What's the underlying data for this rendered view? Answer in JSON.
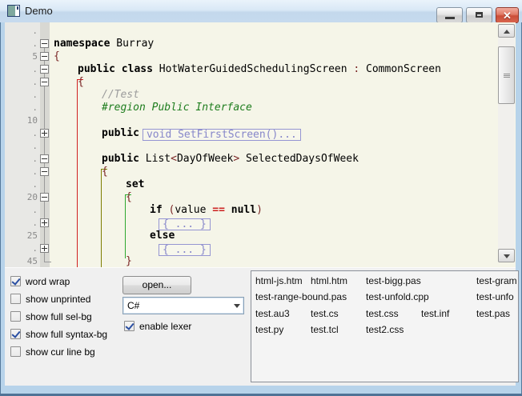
{
  "window": {
    "title": "Demo",
    "buttons": {
      "minimize": "minimize",
      "maximize": "maximize",
      "close": "close"
    }
  },
  "colors": {
    "titlebar_bg": "#D9E8F6",
    "editor_bg": "#F5F5E8",
    "gutter_bg": "#E8E8E5",
    "fold_strip_bg": "#D8D8D3",
    "keyword": "#000000",
    "comment": "#9C9C9C",
    "region_directive": "#1E7D1E",
    "symbol": "#7A2525",
    "operator": "#CC1F1F",
    "folded_text": "#8787CA",
    "scope_red": "#D02020",
    "scope_olive": "#7E7E00",
    "scope_green": "#2EA82E",
    "close_button": "#CB4D38"
  },
  "editor": {
    "rows": [
      {
        "num": ".",
        "fold": "",
        "indent": 0,
        "tokens": []
      },
      {
        "num": ".",
        "fold": "minus",
        "indent": 0,
        "tokens": [
          [
            "kw",
            "namespace"
          ],
          [
            "id",
            " Burray"
          ]
        ]
      },
      {
        "num": "5",
        "fold": "minus",
        "indent": 0,
        "tokens": [
          [
            "sy",
            "{"
          ]
        ]
      },
      {
        "num": ".",
        "fold": "minus",
        "indent": 1,
        "tokens": [
          [
            "kw",
            "public class"
          ],
          [
            "id",
            " HotWaterGuidedSchedulingScreen "
          ],
          [
            "sy",
            ":"
          ],
          [
            "id",
            " CommonScreen"
          ]
        ]
      },
      {
        "num": ".",
        "fold": "minus",
        "indent": 1,
        "tokens": [
          [
            "sy",
            "{"
          ]
        ]
      },
      {
        "num": ".",
        "fold": "",
        "indent": 2,
        "tokens": [
          [
            "cm",
            "//Test"
          ]
        ]
      },
      {
        "num": ".",
        "fold": "",
        "indent": 2,
        "tokens": [
          [
            "rg",
            "#region Public Interface"
          ]
        ]
      },
      {
        "num": "10",
        "fold": "",
        "indent": 0,
        "tokens": []
      },
      {
        "num": ".",
        "fold": "plus",
        "indent": 2,
        "tokens": [
          [
            "kw",
            "public"
          ]
        ],
        "box": "void SetFirstScreen()..."
      },
      {
        "num": ".",
        "fold": "",
        "indent": 0,
        "tokens": []
      },
      {
        "num": ".",
        "fold": "minus",
        "indent": 2,
        "tokens": [
          [
            "kw",
            "public "
          ],
          [
            "id",
            "List"
          ],
          [
            "sy",
            "<"
          ],
          [
            "id",
            "DayOfWeek"
          ],
          [
            "sy",
            ">"
          ],
          [
            "id",
            " SelectedDaysOfWeek"
          ]
        ]
      },
      {
        "num": ".",
        "fold": "minus",
        "indent": 2,
        "tokens": [
          [
            "sy",
            "{"
          ]
        ]
      },
      {
        "num": ".",
        "fold": "",
        "indent": 3,
        "tokens": [
          [
            "kw",
            "set"
          ]
        ]
      },
      {
        "num": "20",
        "fold": "minus",
        "indent": 3,
        "tokens": [
          [
            "sy",
            "{"
          ]
        ]
      },
      {
        "num": ".",
        "fold": "",
        "indent": 4,
        "tokens": [
          [
            "kw",
            "if"
          ],
          [
            "id",
            " "
          ],
          [
            "sy",
            "("
          ],
          [
            "id",
            "value "
          ],
          [
            "op",
            "=="
          ],
          [
            "id",
            " "
          ],
          [
            "kw",
            "null"
          ],
          [
            "sy",
            ")"
          ]
        ]
      },
      {
        "num": ".",
        "fold": "plus",
        "indent": 4,
        "tokens": [],
        "box": "{ ... }"
      },
      {
        "num": "25",
        "fold": "",
        "indent": 4,
        "tokens": [
          [
            "kw",
            "else"
          ]
        ]
      },
      {
        "num": ".",
        "fold": "plus",
        "indent": 4,
        "tokens": [],
        "box": "{ ... }"
      },
      {
        "num": "45",
        "fold": "end",
        "indent": 3,
        "tokens": [
          [
            "sy",
            "}"
          ]
        ]
      }
    ],
    "scope_lines": [
      {
        "color": "#D02020",
        "indent": 1,
        "from_row": 4,
        "to_row": -1
      },
      {
        "color": "#7E7E00",
        "indent": 2,
        "from_row": 11,
        "to_row": -1
      },
      {
        "color": "#2EA82E",
        "indent": 3,
        "from_row": 13,
        "to_row": 18
      }
    ]
  },
  "panel": {
    "checkboxes": [
      {
        "label": "word wrap",
        "checked": true
      },
      {
        "label": "show unprinted",
        "checked": false
      },
      {
        "label": "show full sel-bg",
        "checked": false
      },
      {
        "label": "show full syntax-bg",
        "checked": true
      },
      {
        "label": "show cur line bg",
        "checked": false
      }
    ],
    "open_button": "open...",
    "combo_value": "C#",
    "lexer_checkbox": {
      "label": "enable lexer",
      "checked": true
    }
  },
  "filelist": {
    "items": [
      {
        "label": "html-js.htm",
        "row": 0,
        "col": 0
      },
      {
        "label": "html.htm",
        "row": 0,
        "col": 1
      },
      {
        "label": "test-bigg.pas",
        "row": 0,
        "col": 2
      },
      {
        "label": "test-gram",
        "row": 0,
        "col": 4
      },
      {
        "label": "test-range-bound.pas",
        "row": 1,
        "col": 0
      },
      {
        "label": "test-unfold.cpp",
        "row": 1,
        "col": 2
      },
      {
        "label": "test-unfo",
        "row": 1,
        "col": 4
      },
      {
        "label": "test.au3",
        "row": 2,
        "col": 0
      },
      {
        "label": "test.cs",
        "row": 2,
        "col": 1
      },
      {
        "label": "test.css",
        "row": 2,
        "col": 2
      },
      {
        "label": "test.inf",
        "row": 2,
        "col": 3
      },
      {
        "label": "test.pas",
        "row": 2,
        "col": 4
      },
      {
        "label": "test.py",
        "row": 3,
        "col": 0
      },
      {
        "label": "test.tcl",
        "row": 3,
        "col": 1
      },
      {
        "label": "test2.css",
        "row": 3,
        "col": 2
      }
    ]
  }
}
